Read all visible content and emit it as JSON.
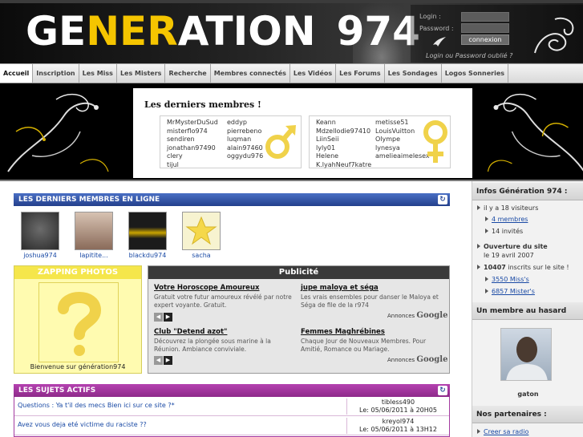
{
  "header": {
    "logo_parts": [
      "GE",
      "NER",
      "ATION",
      "974"
    ],
    "login_label": "Login :",
    "password_label": "Password :",
    "login_button": "connexion",
    "forgot_link": "Login ou Password oublié ?"
  },
  "nav": {
    "tabs": [
      "Accueil",
      "Inscription",
      "Les Miss",
      "Les Misters",
      "Recherche",
      "Membres connectés",
      "Les Vidéos",
      "Les Forums",
      "Les Sondages",
      "Logos Sonneries"
    ],
    "active": "Accueil"
  },
  "latest_members": {
    "title": "Les derniers membres !",
    "male_col1": [
      "MrMysterDuSud",
      "misterflo974",
      "sendiren",
      "jonathan97490",
      "clery",
      "tijul"
    ],
    "male_col2": [
      "eddyp",
      "pierrebeno",
      "luqman",
      "alain97460",
      "oggydu976"
    ],
    "female_col1": [
      "Keann",
      "Mdzellodie97410",
      "LiinSeii",
      "lyly01",
      "Helene",
      "K.lyahNeuf7katre"
    ],
    "female_col2": [
      "metisse51",
      "LouisVuitton",
      "Olympe",
      "lynesya",
      "amelieaimelesex"
    ]
  },
  "online": {
    "title": "LES DERNIERS MEMBRES EN LIGNE",
    "members": [
      "joshua974",
      "lapitite...",
      "blackdu974",
      "sacha"
    ]
  },
  "zapping": {
    "title": "ZAPPING PHOTOS",
    "caption": "Bienvenue sur génération974"
  },
  "pub": {
    "title": "Publicité",
    "ads": [
      {
        "title": "Votre Horoscope Amoureux",
        "desc": "Gratuit votre futur amoureux révélé par notre expert voyante. Gratuit."
      },
      {
        "title": "jupe maloya et séga",
        "desc": "Les vrais ensembles pour danser le Maloya et Séga de file de la r974"
      },
      {
        "title": "Club \"Detend azot\"",
        "desc": "Découvrez la plongée sous marine à la Réunion. Ambiance conviviale."
      },
      {
        "title": "Femmes Maghrébines",
        "desc": "Chaque Jour de Nouveaux Membres. Pour Amitié, Romance ou Mariage."
      }
    ],
    "ads_by": "Annonces",
    "ads_brand": "Google"
  },
  "topics": {
    "title": "LES SUJETS ACTIFS",
    "rows": [
      {
        "question": "Questions : Ya t'il des mecs Bien ici sur ce site ?*",
        "user": "tibless490",
        "date": "Le: 05/06/2011 à 20H05"
      },
      {
        "question": "Avez vous deja eté victime du raciste ??",
        "user": "kreyol974",
        "date": "Le: 05/06/2011 à 13H12"
      }
    ]
  },
  "sidebar": {
    "infos_title": "Infos Génération 974 :",
    "visitors": "il y a 18 visiteurs",
    "members_online": "4 membres",
    "guests": "14 invités",
    "opening_label": "Ouverture du site",
    "opening_date": "le 19 avril 2007",
    "registered_count": "10407",
    "registered_text": "inscrits sur le site !",
    "miss_count": "3550 Miss's",
    "mister_count": "6857 Mister's",
    "random_title": "Un membre au hasard",
    "random_name": "gaton",
    "partners_title": "Nos partenaires :",
    "partner_1": "Creer sa radio"
  }
}
